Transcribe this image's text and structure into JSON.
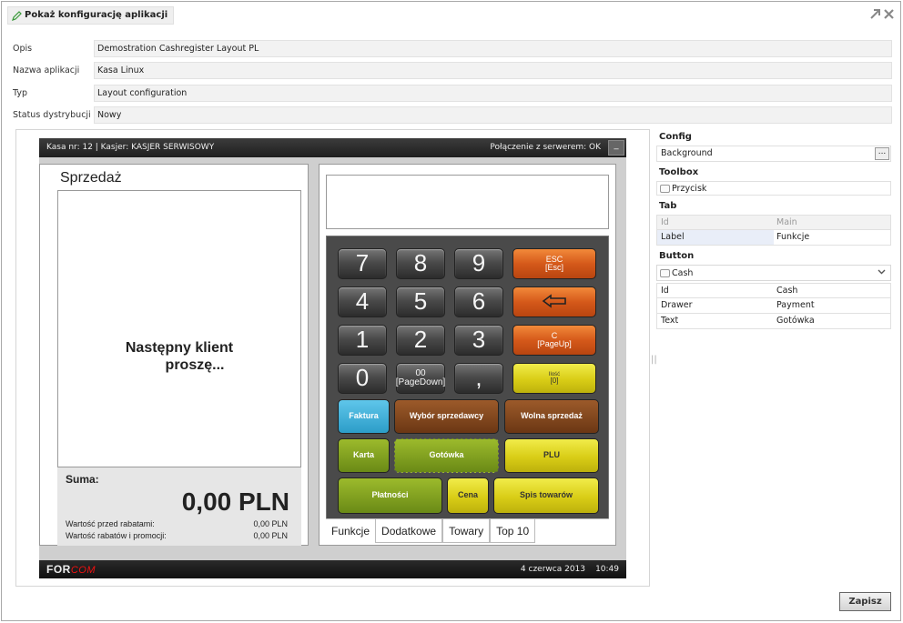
{
  "window": {
    "title": "Pokaż konfigurację aplikacji",
    "expand_icon": "expand-icon",
    "close_icon": "close-icon"
  },
  "fields": [
    {
      "label": "Opis",
      "value": "Demostration Cashregister Layout PL"
    },
    {
      "label": "Nazwa aplikacji",
      "value": "Kasa Linux"
    },
    {
      "label": "Typ",
      "value": "Layout configuration"
    },
    {
      "label": "Status dystrybucji",
      "value": "Nowy"
    }
  ],
  "kasa": {
    "top_left": "Kasa nr: 12   |   Kasjer: KASJER SERWISOWY",
    "top_right": "Połączenie z serwerem: OK",
    "minimize": "_",
    "sales_title": "Sprzedaż",
    "next_client_1": "Następny klient",
    "next_client_2": "proszę...",
    "suma_label": "Suma:",
    "suma_value": "0,00 PLN",
    "before_disc_label": "Wartość przed rabatami:",
    "before_disc_value": "0,00 PLN",
    "disc_label": "Wartość rabatów i promocji:",
    "disc_value": "0,00 PLN",
    "keys": {
      "k7": "7",
      "k8": "8",
      "k9": "9",
      "esc1": "ESC",
      "esc2": "[Esc]",
      "k4": "4",
      "k5": "5",
      "k6": "6",
      "k1": "1",
      "k2": "2",
      "k3": "3",
      "c1": "C",
      "c2": "[PageUp]",
      "k0": "0",
      "k00a": "00",
      "k00b": "[PageDown]",
      "comma": ",",
      "ilosc1": "Ilość",
      "ilosc2": "[0]",
      "faktura": "Faktura",
      "wybor": "Wybór sprzedawcy",
      "wolna": "Wolna sprzedaż",
      "karta": "Karta",
      "gotowka": "Gotówka",
      "plu": "PLU",
      "platnosci": "Płatności",
      "cena": "Cena",
      "spis": "Spis towarów"
    },
    "tabs": [
      "Funkcje",
      "Dodatkowe",
      "Towary",
      "Top 10"
    ],
    "logo_a": "FOR",
    "logo_b": "COM",
    "date": "4 czerwca 2013",
    "time": "10:49"
  },
  "props": {
    "config_h": "Config",
    "background_k": "Background",
    "background_btn": "...",
    "toolbox_h": "Toolbox",
    "przycisk": "Przycisk",
    "tab_h": "Tab",
    "tab_id_k": "Id",
    "tab_id_v": "Main",
    "tab_label_k": "Label",
    "tab_label_v": "Funkcje",
    "button_h": "Button",
    "button_select": "Cash",
    "btn_id_k": "Id",
    "btn_id_v": "Cash",
    "btn_drawer_k": "Drawer",
    "btn_drawer_v": "Payment",
    "btn_text_k": "Text",
    "btn_text_v": "Gotówka"
  },
  "save_label": "Zapisz"
}
